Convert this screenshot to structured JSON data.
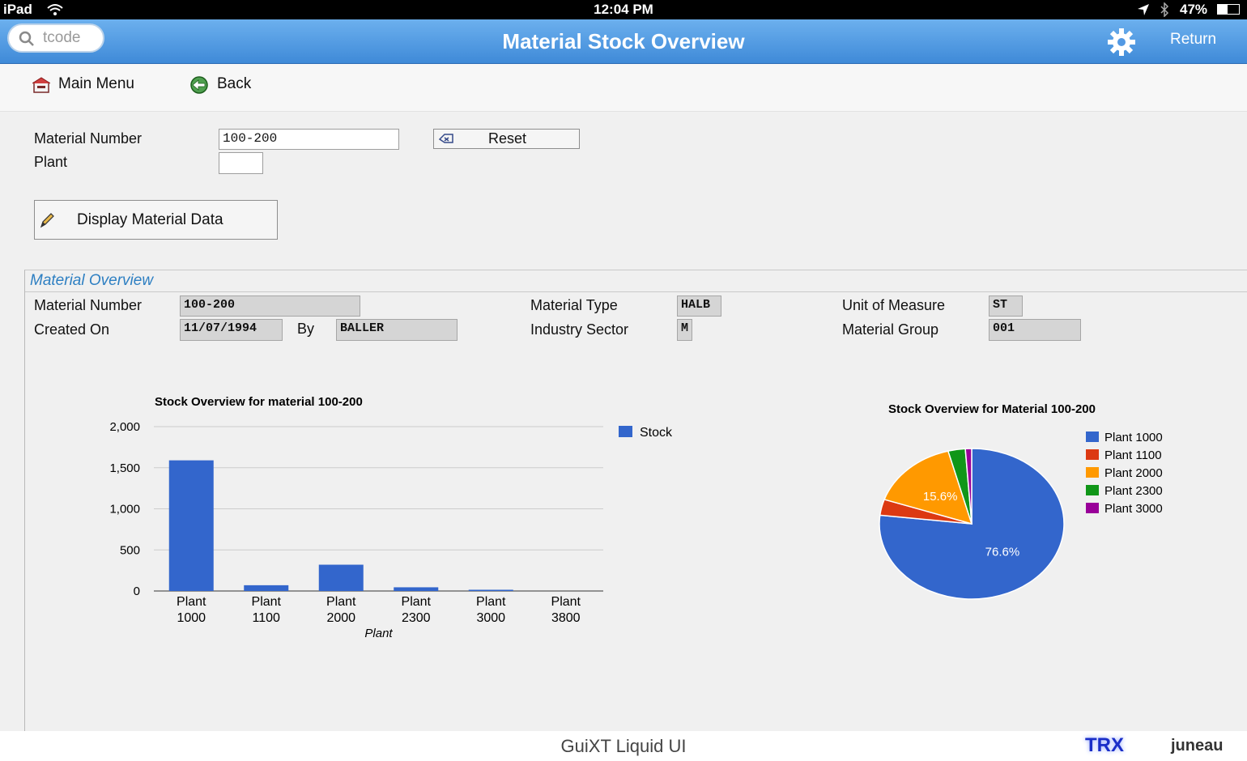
{
  "status": {
    "device": "iPad",
    "time": "12:04 PM",
    "battery": "47%"
  },
  "nav": {
    "search_placeholder": "tcode",
    "title": "Material Stock Overview",
    "return_label": "Return"
  },
  "toolbar": {
    "main_menu": "Main Menu",
    "back": "Back"
  },
  "form": {
    "material_number_label": "Material Number",
    "material_number_value": "100-200",
    "plant_label": "Plant",
    "plant_value": "",
    "reset_label": "Reset",
    "display_button": "Display Material Data"
  },
  "overview": {
    "section_title": "Material Overview",
    "material_number_label": "Material Number",
    "material_number_value": "100-200",
    "created_on_label": "Created On",
    "created_on_value": "11/07/1994",
    "by_label": "By",
    "by_value": "BALLER",
    "material_type_label": "Material Type",
    "material_type_value": "HALB",
    "industry_sector_label": "Industry Sector",
    "industry_sector_value": "M",
    "uom_label": "Unit of Measure",
    "uom_value": "ST",
    "material_group_label": "Material Group",
    "material_group_value": "001"
  },
  "footer": {
    "center": "GuiXT Liquid UI",
    "brand1": "TRX",
    "brand2": "juneau"
  },
  "colors": {
    "blue": "#3366cc",
    "red": "#dc3912",
    "orange": "#ff9900",
    "green": "#109618",
    "purple": "#990099"
  },
  "chart_data": [
    {
      "type": "bar",
      "title": "Stock Overview for material 100-200",
      "categories": [
        "Plant 1000",
        "Plant 1100",
        "Plant 2000",
        "Plant 2300",
        "Plant 3000",
        "Plant 3800"
      ],
      "series": [
        {
          "name": "Stock",
          "values": [
            1590,
            70,
            320,
            45,
            15,
            0
          ]
        }
      ],
      "xlabel": "Plant",
      "ylabel": "",
      "ylim": [
        0,
        2000
      ],
      "yticks": [
        "0",
        "500",
        "1,000",
        "1,500",
        "2,000"
      ],
      "grid": true,
      "legend": "right"
    },
    {
      "type": "pie",
      "title": "Stock Overview for Material 100-200",
      "labels": [
        "Plant 1000",
        "Plant 1100",
        "Plant 2000",
        "Plant 2300",
        "Plant 3000"
      ],
      "values": [
        76.6,
        3.4,
        15.6,
        3.0,
        1.1
      ],
      "slice_labels": [
        "76.6%",
        "",
        "15.6%",
        "",
        ""
      ],
      "legend": "right"
    }
  ]
}
